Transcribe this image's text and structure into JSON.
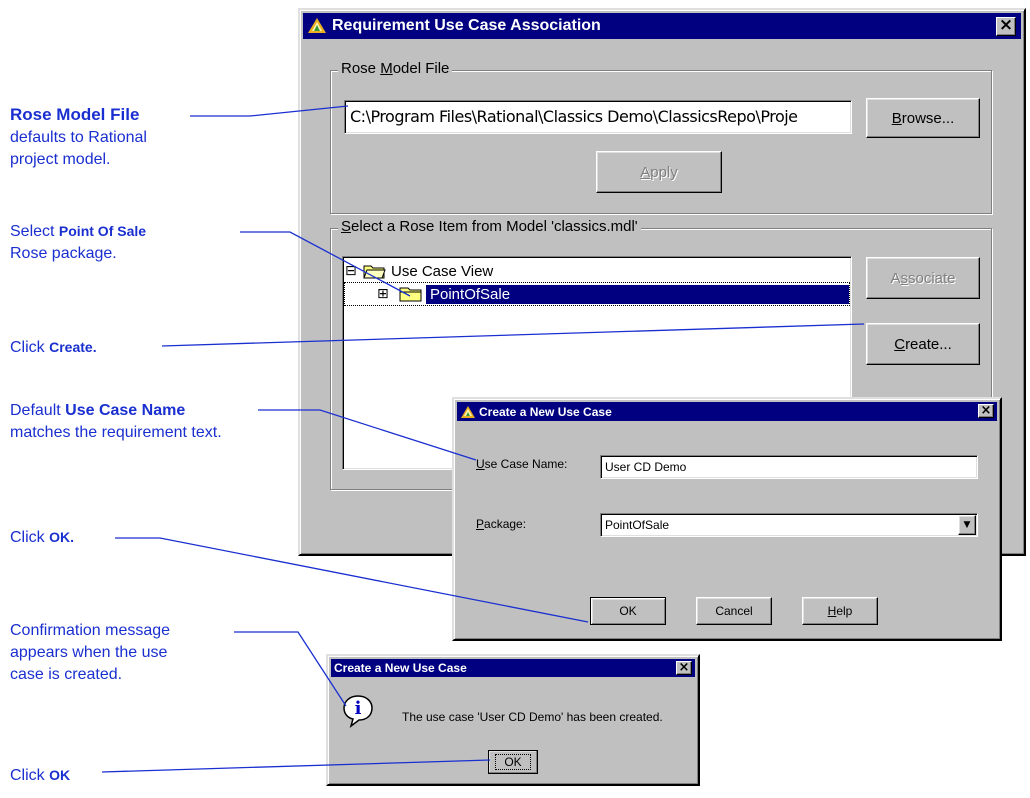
{
  "main_dialog": {
    "title": "Requirement Use Case Association",
    "close_glyph": "×",
    "rose_model_group": {
      "label_pre": "Rose ",
      "label_u": "M",
      "label_post": "odel File",
      "path_value": "C:\\Program Files\\Rational\\Classics Demo\\ClassicsRepo\\Proje",
      "browse_label_u": "B",
      "browse_label_post": "rowse...",
      "apply_label_u": "A",
      "apply_label_post": "pply"
    },
    "select_group": {
      "label_u": "S",
      "label_post": "elect a Rose Item from Model 'classics.mdl'",
      "tree": [
        {
          "expander": "⊟",
          "label": "Use Case View"
        },
        {
          "expander": "⊞",
          "label": "PointOfSale"
        }
      ],
      "associate_pre": "A",
      "associate_u": "s",
      "associate_post": "sociate",
      "create_label_u": "C",
      "create_label_post": "reate..."
    }
  },
  "new_use_case_dialog": {
    "title": "Create a New Use Case",
    "close_glyph": "×",
    "name_label_u": "U",
    "name_label_post": "se Case Name:",
    "name_value": "User CD Demo",
    "package_label_u": "P",
    "package_label_post": "ackage:",
    "package_value": "PointOfSale",
    "dropdown_glyph": "▼",
    "ok_label": "OK",
    "cancel_label": "Cancel",
    "help_label_u": "H",
    "help_label_post": "elp"
  },
  "confirm_dialog": {
    "title": "Create a New Use Case",
    "close_glyph": "×",
    "icon_glyph": "i",
    "message": "The use case 'User CD Demo' has been created.",
    "ok_label": "OK"
  },
  "annotations": {
    "rose_model": {
      "bold": "Rose Model File",
      "rest1": "defaults to Rational",
      "rest2": "project model."
    },
    "select_pos": {
      "pre": "Select ",
      "bold": "Point Of Sale",
      "rest": "Rose package."
    },
    "click_create": {
      "pre": "Click ",
      "bold": "Create."
    },
    "default_name": {
      "pre": "Default ",
      "bold": "Use Case Name",
      "rest": "matches the requirement text."
    },
    "click_ok1": {
      "pre": "Click ",
      "bold": "OK."
    },
    "confirmation": {
      "line1": "Confirmation message",
      "line2": "appears when the use",
      "line3": "case is created."
    },
    "click_ok2": {
      "pre": "Click ",
      "bold": "OK"
    }
  },
  "colors": {
    "annotation": "#1a2fd0",
    "title_bar": "#000080",
    "dialog_face": "#c0c0c0",
    "selection": "#000080"
  }
}
